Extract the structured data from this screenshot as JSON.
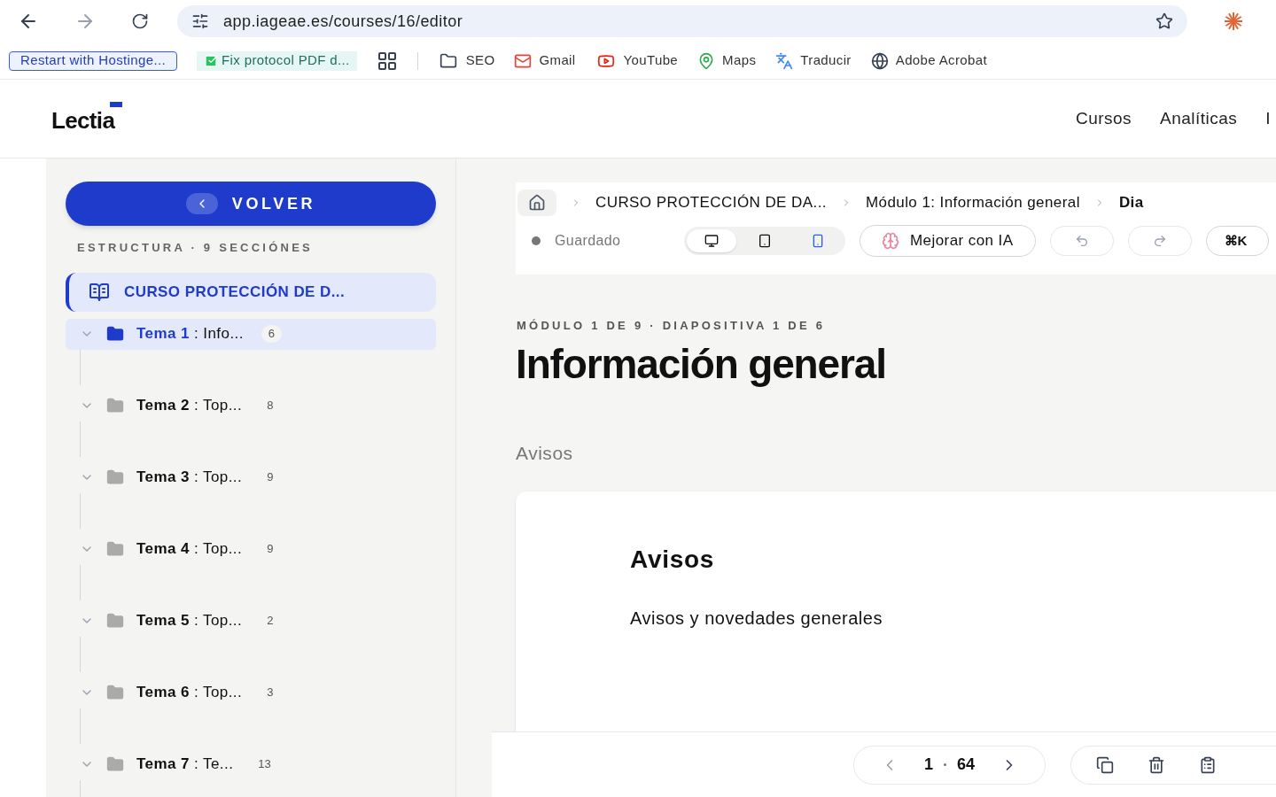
{
  "browser": {
    "url": "app.iageae.es/courses/16/editor",
    "bookmarks": [
      {
        "label": "Restart with Hostinge...",
        "kind": "outlined"
      },
      {
        "label": "Fix protocol PDF d...",
        "kind": "check"
      },
      {
        "label": "SEO",
        "kind": "folder"
      },
      {
        "label": "Gmail",
        "kind": "gmail"
      },
      {
        "label": "YouTube",
        "kind": "youtube"
      },
      {
        "label": "Maps",
        "kind": "maps"
      },
      {
        "label": "Traducir",
        "kind": "translate"
      },
      {
        "label": "Adobe Acrobat",
        "kind": "globe"
      }
    ]
  },
  "header": {
    "logo": "Lectia",
    "nav": [
      "Cursos",
      "Analíticas",
      "I"
    ]
  },
  "sidebar": {
    "back_button": "VOLVER",
    "structure_label": "ESTRUCTURA · 9 SECCIÓNES",
    "course": "CURSO PROTECCIÓN DE D...",
    "topics": [
      {
        "tema": "Tema 1",
        "title": ": Info...",
        "count": "6",
        "selected": true
      },
      {
        "tema": "Tema 2",
        "title": ": Top...",
        "count": "8",
        "selected": false
      },
      {
        "tema": "Tema 3",
        "title": ": Top...",
        "count": "9",
        "selected": false
      },
      {
        "tema": "Tema 4",
        "title": ": Top...",
        "count": "9",
        "selected": false
      },
      {
        "tema": "Tema 5",
        "title": ": Top...",
        "count": "2",
        "selected": false
      },
      {
        "tema": "Tema 6",
        "title": ": Top...",
        "count": "3",
        "selected": false
      },
      {
        "tema": "Tema 7",
        "title": ": Te...",
        "count": "13",
        "selected": false
      }
    ]
  },
  "toolbar": {
    "breadcrumb": [
      "CURSO PROTECCIÓN DE DA...",
      "Módulo 1: Información general",
      "Dia"
    ],
    "status": "Guardado",
    "devices": [
      {
        "kind": "desktop",
        "selected": true
      },
      {
        "kind": "tablet",
        "selected": false
      },
      {
        "kind": "mobile",
        "selected": false
      }
    ],
    "ai_button": "Mejorar con IA",
    "shortcut": "⌘K"
  },
  "content": {
    "eyebrow": "MÓDULO 1 DE 9 · DIAPOSITIVA 1 DE 6",
    "heading": "Información general",
    "section_label": "Avisos",
    "card": {
      "title": "Avisos",
      "text": "Avisos y novedades generales"
    }
  },
  "footer": {
    "page": "1",
    "total": "64"
  }
}
